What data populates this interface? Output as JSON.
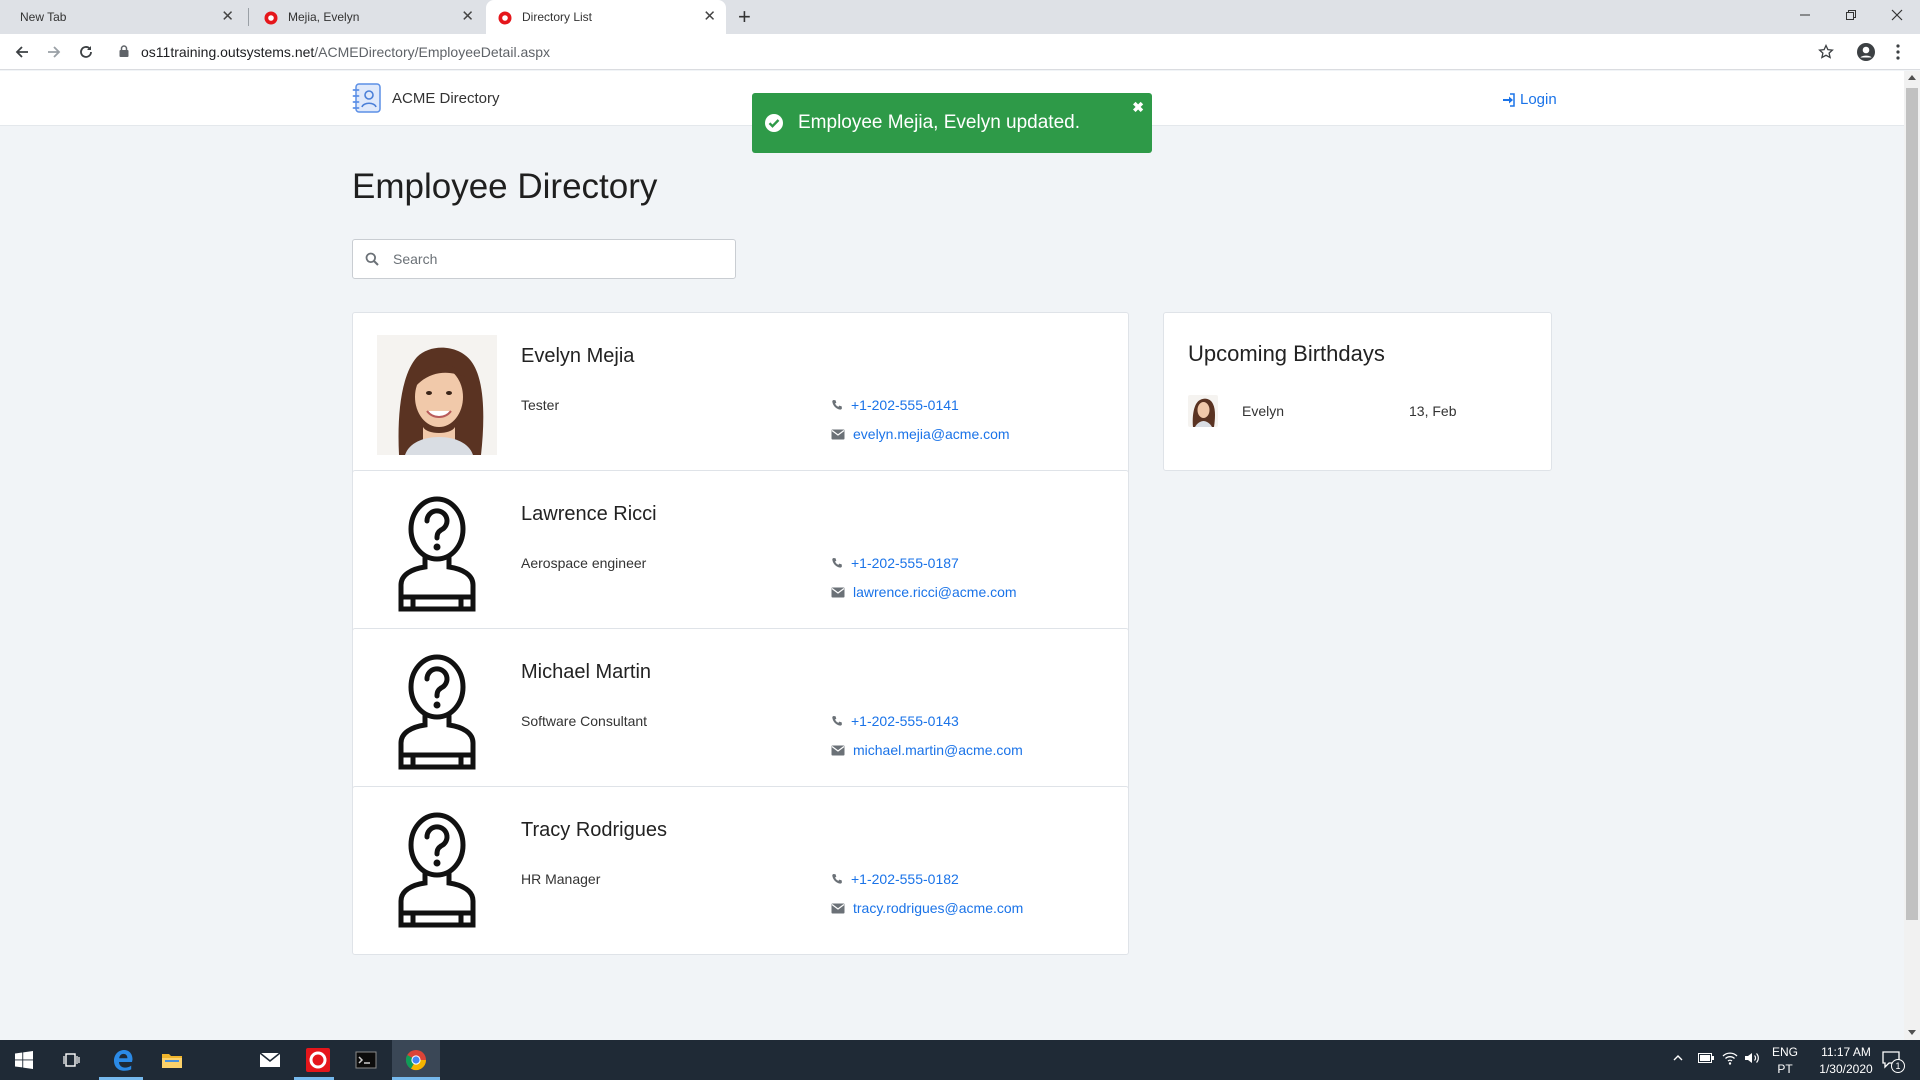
{
  "browser": {
    "tabs": [
      {
        "title": "New Tab",
        "close": "✕"
      },
      {
        "title": "Mejia, Evelyn",
        "close": "✕"
      },
      {
        "title": "Directory List",
        "close": "✕"
      }
    ],
    "new_tab": "+",
    "url_host": "os11training.outsystems.net",
    "url_path": "/ACMEDirectory/EmployeeDetail.aspx"
  },
  "app": {
    "brand": "ACME Directory",
    "login": "Login",
    "toast": {
      "message": "Employee Mejia, Evelyn updated.",
      "close": "✖"
    },
    "page_title": "Employee Directory",
    "search_placeholder": "Search",
    "employees": [
      {
        "name": "Evelyn Mejia",
        "role": "Tester",
        "phone": "+1-202-555-0141",
        "email": "evelyn.mejia@acme.com",
        "photo": "evelyn-photo"
      },
      {
        "name": "Lawrence Ricci",
        "role": "Aerospace engineer",
        "phone": "+1-202-555-0187",
        "email": "lawrence.ricci@acme.com",
        "photo": "unknown-person-icon"
      },
      {
        "name": "Michael Martin",
        "role": "Software Consultant",
        "phone": "+1-202-555-0143",
        "email": "michael.martin@acme.com",
        "photo": "unknown-person-icon"
      },
      {
        "name": "Tracy Rodrigues",
        "role": "HR Manager",
        "phone": "+1-202-555-0182",
        "email": "tracy.rodrigues@acme.com",
        "photo": "unknown-person-icon"
      }
    ],
    "birthdays": {
      "title": "Upcoming Birthdays",
      "items": [
        {
          "name": "Evelyn",
          "date": "13, Feb"
        }
      ]
    },
    "colors": {
      "accent": "#1a73e8",
      "toast": "#2e9a48"
    }
  },
  "taskbar": {
    "lang": "ENG",
    "layout": "PT",
    "time": "11:17 AM",
    "date": "1/30/2020",
    "notifications": "1"
  }
}
